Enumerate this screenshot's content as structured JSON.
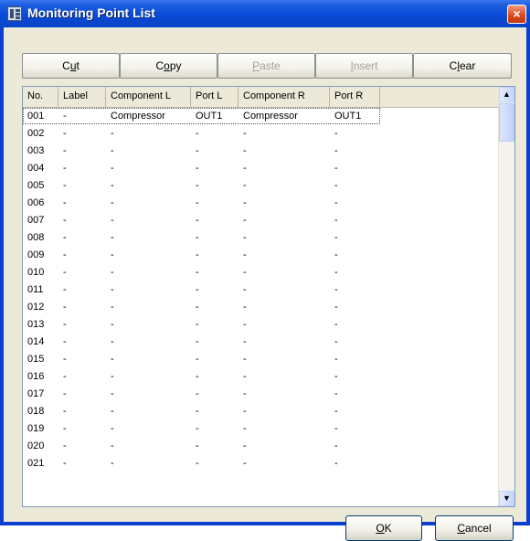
{
  "window": {
    "title": "Monitoring Point List",
    "close_glyph": "×"
  },
  "toolbar": [
    {
      "label": "Cut",
      "underline": "u",
      "enabled": true
    },
    {
      "label": "Copy",
      "underline": "o",
      "enabled": true
    },
    {
      "label": "Paste",
      "underline": "P",
      "enabled": false
    },
    {
      "label": "Insert",
      "underline": "I",
      "enabled": false
    },
    {
      "label": "Clear",
      "underline": "l",
      "enabled": true
    }
  ],
  "columns": [
    "No.",
    "Label",
    "Component L",
    "Port L",
    "Component R",
    "Port R"
  ],
  "rows": [
    [
      "001",
      "-",
      "Compressor",
      "OUT1",
      "Compressor",
      "OUT1"
    ],
    [
      "002",
      "-",
      "-",
      "-",
      "-",
      "-"
    ],
    [
      "003",
      "-",
      "-",
      "-",
      "-",
      "-"
    ],
    [
      "004",
      "-",
      "-",
      "-",
      "-",
      "-"
    ],
    [
      "005",
      "-",
      "-",
      "-",
      "-",
      "-"
    ],
    [
      "006",
      "-",
      "-",
      "-",
      "-",
      "-"
    ],
    [
      "007",
      "-",
      "-",
      "-",
      "-",
      "-"
    ],
    [
      "008",
      "-",
      "-",
      "-",
      "-",
      "-"
    ],
    [
      "009",
      "-",
      "-",
      "-",
      "-",
      "-"
    ],
    [
      "010",
      "-",
      "-",
      "-",
      "-",
      "-"
    ],
    [
      "011",
      "-",
      "-",
      "-",
      "-",
      "-"
    ],
    [
      "012",
      "-",
      "-",
      "-",
      "-",
      "-"
    ],
    [
      "013",
      "-",
      "-",
      "-",
      "-",
      "-"
    ],
    [
      "014",
      "-",
      "-",
      "-",
      "-",
      "-"
    ],
    [
      "015",
      "-",
      "-",
      "-",
      "-",
      "-"
    ],
    [
      "016",
      "-",
      "-",
      "-",
      "-",
      "-"
    ],
    [
      "017",
      "-",
      "-",
      "-",
      "-",
      "-"
    ],
    [
      "018",
      "-",
      "-",
      "-",
      "-",
      "-"
    ],
    [
      "019",
      "-",
      "-",
      "-",
      "-",
      "-"
    ],
    [
      "020",
      "-",
      "-",
      "-",
      "-",
      "-"
    ],
    [
      "021",
      "-",
      "-",
      "-",
      "-",
      "-"
    ]
  ],
  "selected_row": "001",
  "footer": {
    "ok_label": "OK",
    "ok_underline": "O",
    "cancel_label": "Cancel",
    "cancel_underline": "C"
  },
  "scrollbar": {
    "up_icon": "▲",
    "down_icon": "▼"
  },
  "colors": {
    "title_bar": "#0a4ad6",
    "dialog_face": "#ece9d8",
    "close_button": "#d8461b"
  }
}
